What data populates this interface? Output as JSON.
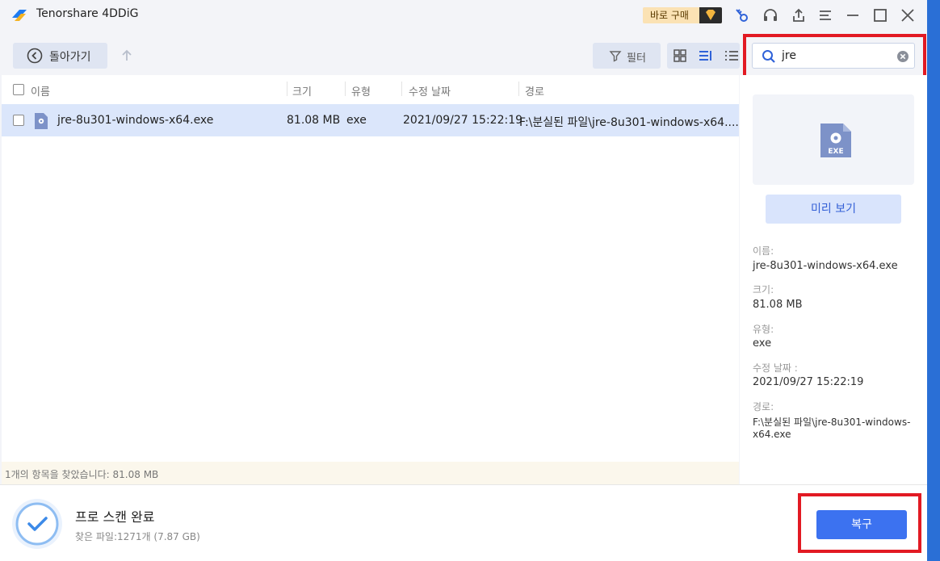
{
  "app": {
    "title": "Tenorshare 4DDiG",
    "buy_label": "바로 구매"
  },
  "toolbar": {
    "back_label": "돌아가기",
    "filter_label": "필터",
    "search_value": "jre"
  },
  "table": {
    "headers": {
      "name": "이름",
      "size": "크기",
      "type": "유형",
      "modified": "수정 날짜",
      "path": "경로"
    },
    "rows": [
      {
        "name": "jre-8u301-windows-x64.exe",
        "size": "81.08 MB",
        "type": "exe",
        "modified": "2021/09/27 15:22:19",
        "path": "F:\\분실된 파일\\jre-8u301-windows-x64...."
      }
    ],
    "status": "1개의 항목을 찾았습니다: 81.08 MB"
  },
  "details": {
    "preview_label": "미리 보기",
    "thumb_badge": "EXE",
    "name_label": "이름:",
    "name_value": "jre-8u301-windows-x64.exe",
    "size_label": "크기:",
    "size_value": "81.08 MB",
    "type_label": "유형:",
    "type_value": "exe",
    "modified_label": "수정 날짜 :",
    "modified_value": "2021/09/27 15:22:19",
    "path_label": "경로:",
    "path_value_line1": "F:\\분실된 파일\\jre-8u301-windows-",
    "path_value_line2": "x64.exe"
  },
  "footer": {
    "scan_title": "프로 스캔 완료",
    "scan_sub": "찾은 파일:1271개 (7.87 GB)",
    "recover_label": "복구"
  },
  "colors": {
    "accent": "#3c72f0",
    "highlight": "#e21a23",
    "selected_row": "#dbe6fb"
  },
  "icons": [
    "app-logo",
    "gem-icon",
    "key-icon",
    "headset-icon",
    "share-icon",
    "menu-icon",
    "minimize-icon",
    "maximize-icon",
    "close-icon",
    "back-icon",
    "up-arrow-icon",
    "filter-icon",
    "grid-view-icon",
    "list-view-icon",
    "detail-view-icon",
    "search-icon",
    "clear-icon",
    "exe-file-icon",
    "check-circle-icon"
  ]
}
